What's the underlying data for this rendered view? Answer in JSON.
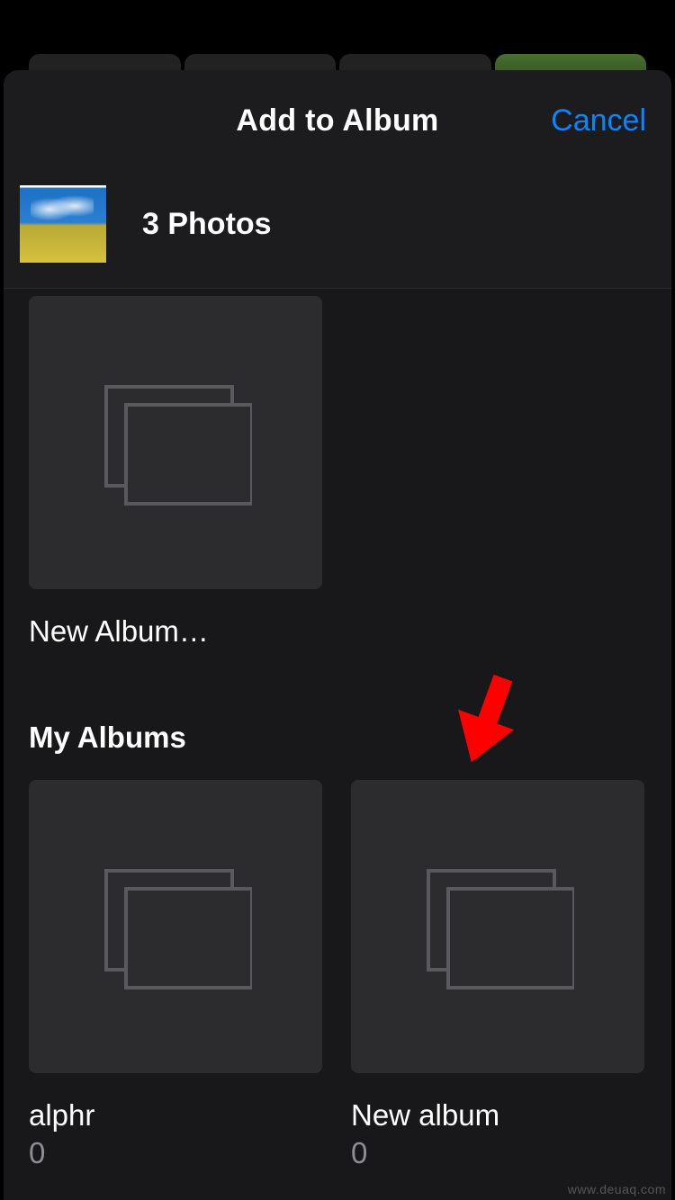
{
  "header": {
    "title": "Add to Album",
    "cancel": "Cancel"
  },
  "selection": {
    "count_label": "3 Photos"
  },
  "new_album": {
    "label": "New Album…"
  },
  "my_albums": {
    "section_title": "My Albums",
    "items": [
      {
        "name": "alphr",
        "count": "0"
      },
      {
        "name": "New album",
        "count": "0"
      }
    ]
  },
  "watermark": "www.deuaq.com",
  "colors": {
    "accent": "#0a84ff",
    "arrow": "#ff0000"
  }
}
